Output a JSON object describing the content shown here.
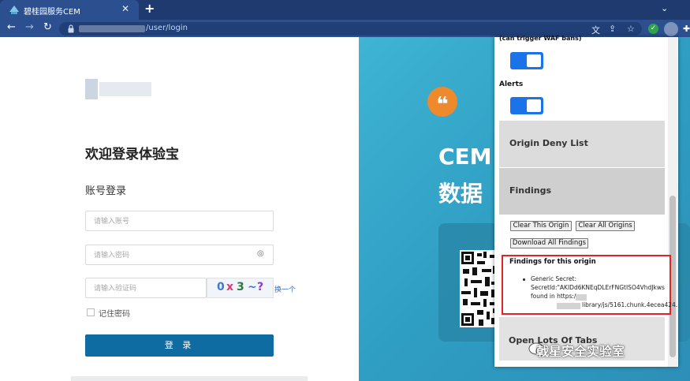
{
  "browser": {
    "tab_title": "碧桂园服务CEM",
    "tab_close": "✕",
    "new_tab": "+",
    "tab_menu": "⌄",
    "url_path": "/user/login",
    "icons": [
      "back-arrow-icon",
      "forward-arrow-icon",
      "reload-icon",
      "lock-icon",
      "translate-icon",
      "share-icon",
      "star-icon",
      "extension-icon",
      "profile-avatar-icon",
      "puzzle-icon"
    ]
  },
  "login": {
    "welcome_title": "欢迎登录体验宝",
    "account_login": "账号登录",
    "username_placeholder": "请输入账号",
    "password_placeholder": "请输入密码",
    "captcha_placeholder": "请输入验证码",
    "captcha_chars": [
      "0",
      "x",
      "3",
      "~",
      "?"
    ],
    "captcha_refresh": "换一个",
    "remember_label": "记住密码",
    "login_button": "登 录",
    "accent_color": "#0e6ca3"
  },
  "hero": {
    "line1": "CEM",
    "line2": "数据",
    "quote_glyph": "❝",
    "quote_color": "#ee8a2c"
  },
  "extension_popup": {
    "waf_label": "(can trigger WAF bans)",
    "alerts_label": "Alerts",
    "origin_deny_list": "Origin Deny List",
    "findings_section": "Findings",
    "clear_this_origin": "Clear This Origin",
    "clear_all_origins": "Clear All Origins",
    "download_all_findings": "Download All Findings",
    "findings_title": "Findings for this origin",
    "finding_line1": "Generic Secret:",
    "finding_line2": "SecretId:\"AKIDd6KNEqDLErFNGtISO4VhdJkws",
    "finding_line3": "found in https:/",
    "finding_line4": "library/js/5161.chunk.4ecea424.",
    "open_tabs": "Open Lots Of Tabs",
    "toggle_color": "#1a73e8",
    "highlight_color": "#e32424"
  },
  "watermark": {
    "text": "戟星安全实验室"
  }
}
